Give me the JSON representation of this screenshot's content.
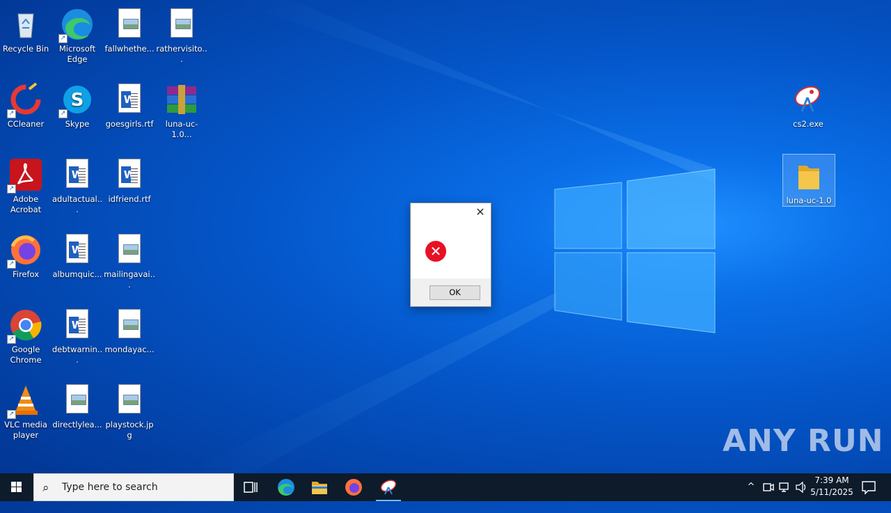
{
  "desktop": {
    "icons": [
      {
        "label": "Recycle Bin"
      },
      {
        "label": "Microsoft Edge"
      },
      {
        "label": "fallwhethe..."
      },
      {
        "label": "rathervisito..."
      },
      {
        "label": "CCleaner"
      },
      {
        "label": "Skype"
      },
      {
        "label": "goesgirls.rtf"
      },
      {
        "label": "luna-uc-1.0..."
      },
      {
        "label": "Adobe Acrobat"
      },
      {
        "label": "adultactual..."
      },
      {
        "label": "idfriend.rtf"
      },
      {
        "label": "Firefox"
      },
      {
        "label": "albumquic..."
      },
      {
        "label": "mailingavai..."
      },
      {
        "label": "Google Chrome"
      },
      {
        "label": "debtwarnin..."
      },
      {
        "label": "mondayac..."
      },
      {
        "label": "VLC media player"
      },
      {
        "label": "directlylea..."
      },
      {
        "label": "playstock.jpg"
      },
      {
        "label": "cs2.exe"
      },
      {
        "label": "luna-uc-1.0"
      }
    ]
  },
  "dialog": {
    "ok_label": "OK"
  },
  "taskbar": {
    "search_placeholder": "Type here to search",
    "clock_time": "7:39 AM",
    "clock_date": "5/11/2025"
  },
  "watermark": "ANY RUN",
  "colors": {
    "desktop_blue": "#0456c9",
    "error_red": "#e81123",
    "taskbar_bg": "#0d1b2b"
  }
}
